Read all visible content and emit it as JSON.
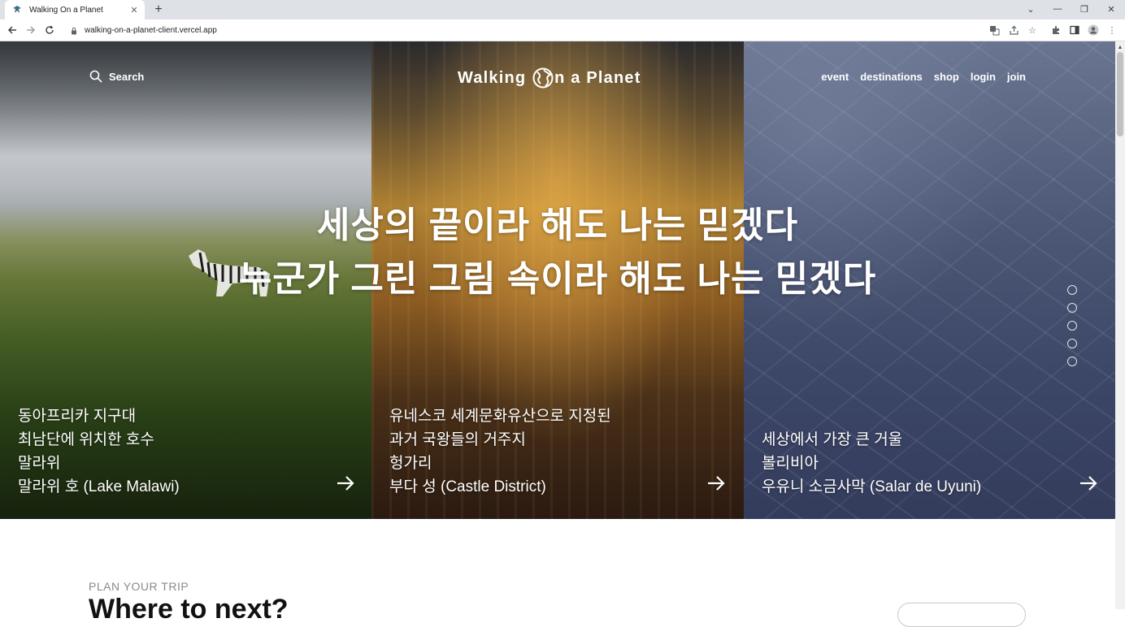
{
  "browser": {
    "tab_title": "Walking On a Planet",
    "url": "walking-on-a-planet-client.vercel.app",
    "new_tab_label": "+",
    "window_controls": [
      "chevron-down-icon",
      "minimize-icon",
      "restore-icon",
      "close-icon"
    ],
    "toolbar_icons": [
      "translate-icon",
      "share-icon",
      "star-icon",
      "extensions-icon",
      "side-panel-icon",
      "profile-icon",
      "menu-icon"
    ]
  },
  "header": {
    "search_label": "Search",
    "logo_part1": "Walking ",
    "logo_part2": "n a Planet",
    "nav": [
      "event",
      "destinations",
      "shop",
      "login",
      "join"
    ]
  },
  "hero": {
    "headline_line1": "세상의 끝이라 해도 나는 믿겠다",
    "headline_line2": "누군가 그린 그림 속이라 해도 나는 믿겠다",
    "slide_count": 5,
    "destinations": [
      {
        "lines": [
          "동아프리카 지구대",
          "최남단에 위치한 호수",
          "말라위",
          "말라위 호 (Lake Malawi)"
        ]
      },
      {
        "lines": [
          "유네스코 세계문화유산으로 지정된",
          "과거 국왕들의 거주지",
          "헝가리",
          "부다 성 (Castle District)"
        ]
      },
      {
        "lines": [
          "세상에서 가장 큰 거울",
          "볼리비아",
          "우유니 소금사막 (Salar de Uyuni)"
        ]
      }
    ]
  },
  "plan": {
    "kicker": "PLAN YOUR TRIP",
    "title": "Where to next?"
  },
  "colors": {
    "accent_text": "#ffffff",
    "chrome_bg": "#dee1e6",
    "kicker": "#8a8a8a"
  }
}
